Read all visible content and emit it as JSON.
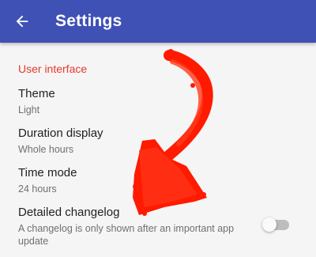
{
  "appbar": {
    "title": "Settings",
    "back_icon": "arrow-back-icon",
    "color": "#3f51b5"
  },
  "section": {
    "header": "User interface",
    "header_color": "#e8392c"
  },
  "preferences": [
    {
      "title": "Theme",
      "summary": "Light"
    },
    {
      "title": "Duration display",
      "summary": "Whole hours"
    },
    {
      "title": "Time mode",
      "summary": "24 hours"
    },
    {
      "title": "Detailed changelog",
      "summary": "A changelog is only shown after an important app update",
      "switch_on": false
    }
  ],
  "annotation": {
    "icon": "red-arrow-annotation",
    "color": "#ff1a00"
  }
}
